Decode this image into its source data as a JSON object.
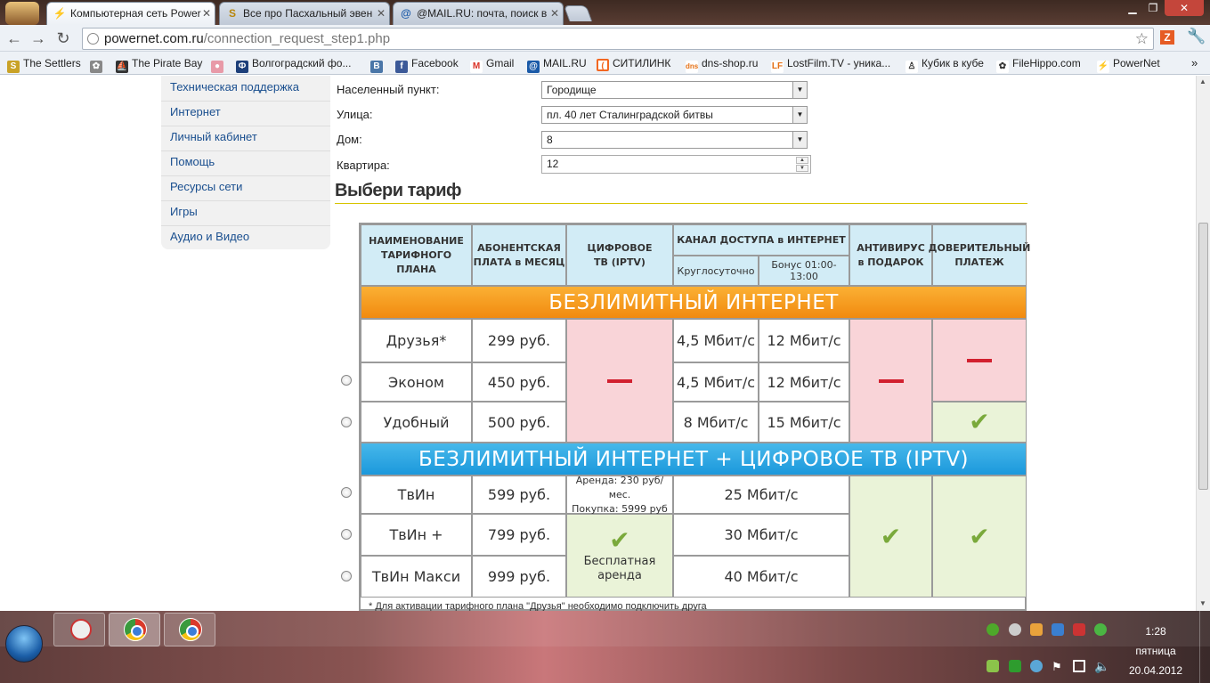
{
  "tabs": [
    {
      "title": "Компьютерная сеть Power",
      "icon": "powernet-bolt-icon"
    },
    {
      "title": "Все про Пасхальный эвен",
      "icon": "settlers-icon"
    },
    {
      "title": "@MAIL.RU: почта, поиск в",
      "icon": "mailru-icon"
    }
  ],
  "address": {
    "host": "powernet.com.ru",
    "path": "/connection_request_step1.php"
  },
  "bookmarks": [
    "The Settlers",
    "The Pirate Bay",
    "Волгоградский фо...",
    "Facebook",
    "Gmail",
    "MAIL.RU",
    "СИТИЛИНК",
    "dns-shop.ru",
    "LostFilm.TV - уника...",
    "Кубик в кубе",
    "FileHippo.com",
    "PowerNet"
  ],
  "sidebar": {
    "items": [
      "Техническая поддержка",
      "Интернет",
      "Личный кабинет",
      "Помощь",
      "Ресурсы сети",
      "Игры",
      "Аудио и Видео"
    ]
  },
  "form": {
    "settlement": {
      "label": "Населенный пункт:",
      "value": "Городище"
    },
    "street": {
      "label": "Улица:",
      "value": "пл. 40 лет Сталинградской битвы"
    },
    "house": {
      "label": "Дом:",
      "value": "8"
    },
    "apartment": {
      "label": "Квартира:",
      "value": "12"
    }
  },
  "section_title": "Выбери тариф",
  "table": {
    "headers": {
      "plan": "НАИМЕНОВАНИЕ ТАРИФНОГО ПЛАНА",
      "fee": "АБОНЕНТСКАЯ ПЛАТА в МЕСЯЦ",
      "tv": "ЦИФРОВОЕ ТВ (IPTV)",
      "channel": "КАНАЛ ДОСТУПА в ИНТЕРНЕТ",
      "channel_day": "Круглосуточно",
      "channel_bonus": "Бонус 01:00-13:00",
      "antivirus": "АНТИВИРУС в ПОДАРОК",
      "trust": "ДОВЕРИТЕЛЬНЫЙ ПЛАТЕЖ"
    },
    "band1": "БЕЗЛИМИТНЫЙ ИНТЕРНЕТ",
    "band2": "БЕЗЛИМИТНЫЙ ИНТЕРНЕТ + ЦИФРОВОЕ ТВ (IPTV)",
    "group1": [
      {
        "name": "Друзья*",
        "price": "299 руб.",
        "speed": "4,5 Мбит/с",
        "bonus": "12 Мбит/с"
      },
      {
        "name": "Эконом",
        "price": "450 руб.",
        "speed": "4,5 Мбит/с",
        "bonus": "12 Мбит/с"
      },
      {
        "name": "Удобный",
        "price": "500 руб.",
        "speed": "8 Мбит/с",
        "bonus": "15 Мбит/с"
      }
    ],
    "group2": [
      {
        "name": "ТвИн",
        "price": "599 руб.",
        "speed": "25 Мбит/с"
      },
      {
        "name": "ТвИн +",
        "price": "799 руб.",
        "speed": "30 Мбит/с"
      },
      {
        "name": "ТвИн Макси",
        "price": "999 руб.",
        "speed": "40 Мбит/с"
      }
    ],
    "rent_line1": "Аренда: 230  руб/мес.",
    "rent_line2": "Покупка: 5999 руб",
    "free_rent": "Бесплатная аренда",
    "footnote": "* Для активации тарифного плана \"Друзья\" необходимо подключить друга"
  },
  "clock": {
    "time": "1:28",
    "day": "пятница",
    "date": "20.04.2012"
  }
}
